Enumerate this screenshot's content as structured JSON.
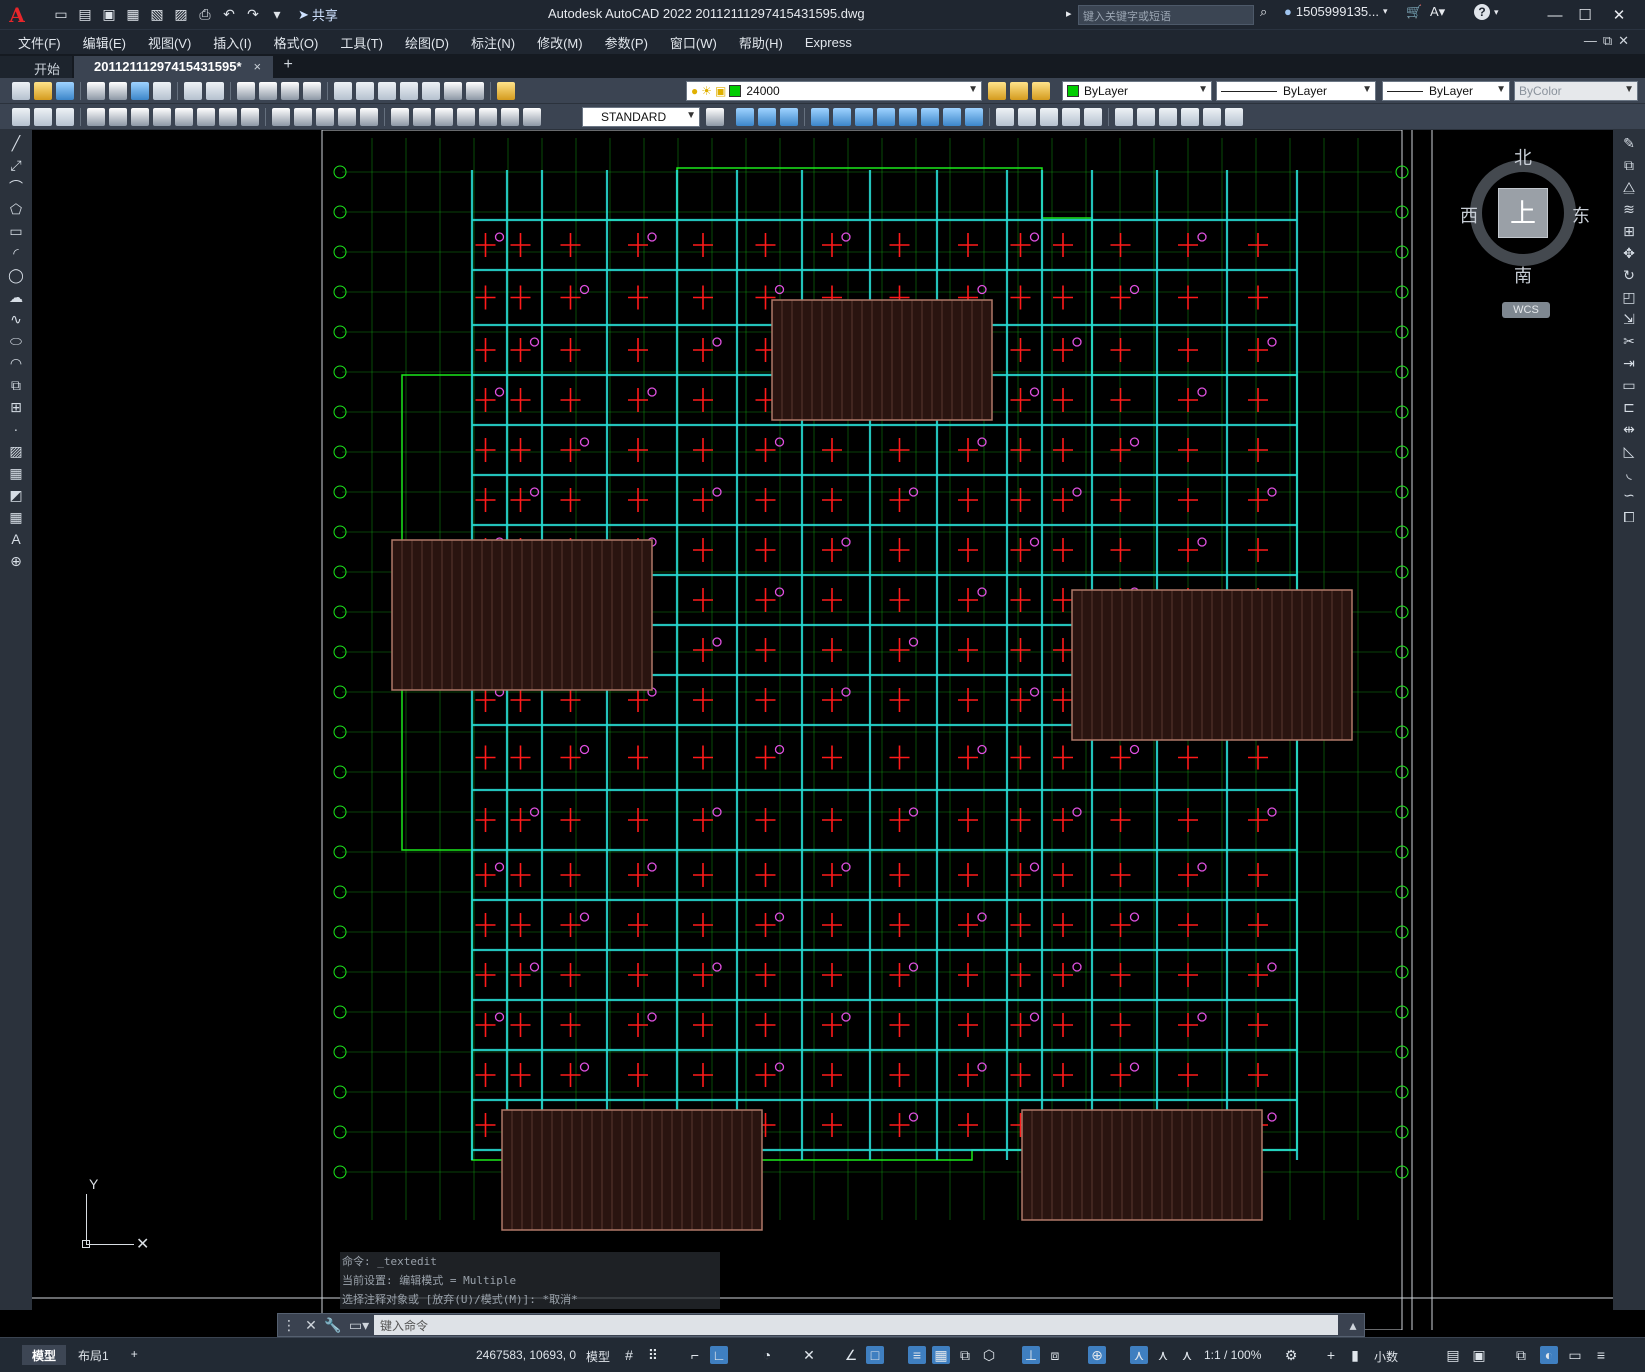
{
  "app": {
    "logo": "A",
    "title": "Autodesk AutoCAD 2022    20112111297415431595.dwg",
    "search_placeholder": "键入关键字或短语",
    "user": "1505999135...",
    "share_label": "共享",
    "help": "?"
  },
  "menu": [
    "文件(F)",
    "编辑(E)",
    "视图(V)",
    "插入(I)",
    "格式(O)",
    "工具(T)",
    "绘图(D)",
    "标注(N)",
    "修改(M)",
    "参数(P)",
    "窗口(W)",
    "帮助(H)",
    "Express"
  ],
  "tabs": {
    "start": "开始",
    "file": "20112111297415431595*",
    "close": "×",
    "add": "+"
  },
  "toolbar": {
    "layer_value": "24000",
    "color_value": "ByLayer",
    "linetype_value": "ByLayer",
    "lineweight_value": "ByLayer",
    "plotstyle_value": "ByColor",
    "textstyle_value": "STANDARD"
  },
  "colors": {
    "layer_swatch": "#00cc00",
    "color_swatch": "#00cc00",
    "grid_cyan": "#27d7d0",
    "outline_green": "#1be81b",
    "rebar_red": "#ff1a1a",
    "marker_magenta": "#e050e0",
    "hatch_brown": "#b07868"
  },
  "viewcube": {
    "north": "北",
    "south": "南",
    "east": "东",
    "west": "西",
    "face": "上",
    "wcs": "WCS"
  },
  "ucs": {
    "y_label": "Y"
  },
  "command": {
    "history": [
      "命令: _textedit",
      "当前设置: 编辑模式 = Multiple",
      "选择注释对象或 [放弃(U)/模式(M)]: *取消*"
    ],
    "placeholder": "键入命令"
  },
  "status": {
    "tabs": [
      "模型",
      "布局1"
    ],
    "add": "+",
    "coords": "2467583, 10693, 0",
    "mode": "模型",
    "scale": "1:1 / 100%",
    "units": "小数"
  }
}
